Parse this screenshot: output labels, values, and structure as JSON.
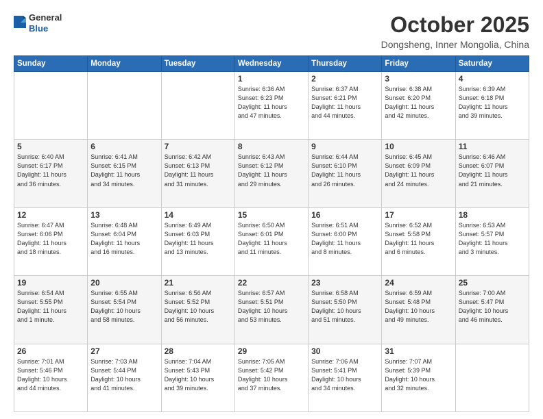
{
  "header": {
    "logo_general": "General",
    "logo_blue": "Blue",
    "month_title": "October 2025",
    "location": "Dongsheng, Inner Mongolia, China"
  },
  "weekdays": [
    "Sunday",
    "Monday",
    "Tuesday",
    "Wednesday",
    "Thursday",
    "Friday",
    "Saturday"
  ],
  "weeks": [
    [
      {
        "day": "",
        "info": ""
      },
      {
        "day": "",
        "info": ""
      },
      {
        "day": "",
        "info": ""
      },
      {
        "day": "1",
        "info": "Sunrise: 6:36 AM\nSunset: 6:23 PM\nDaylight: 11 hours\nand 47 minutes."
      },
      {
        "day": "2",
        "info": "Sunrise: 6:37 AM\nSunset: 6:21 PM\nDaylight: 11 hours\nand 44 minutes."
      },
      {
        "day": "3",
        "info": "Sunrise: 6:38 AM\nSunset: 6:20 PM\nDaylight: 11 hours\nand 42 minutes."
      },
      {
        "day": "4",
        "info": "Sunrise: 6:39 AM\nSunset: 6:18 PM\nDaylight: 11 hours\nand 39 minutes."
      }
    ],
    [
      {
        "day": "5",
        "info": "Sunrise: 6:40 AM\nSunset: 6:17 PM\nDaylight: 11 hours\nand 36 minutes."
      },
      {
        "day": "6",
        "info": "Sunrise: 6:41 AM\nSunset: 6:15 PM\nDaylight: 11 hours\nand 34 minutes."
      },
      {
        "day": "7",
        "info": "Sunrise: 6:42 AM\nSunset: 6:13 PM\nDaylight: 11 hours\nand 31 minutes."
      },
      {
        "day": "8",
        "info": "Sunrise: 6:43 AM\nSunset: 6:12 PM\nDaylight: 11 hours\nand 29 minutes."
      },
      {
        "day": "9",
        "info": "Sunrise: 6:44 AM\nSunset: 6:10 PM\nDaylight: 11 hours\nand 26 minutes."
      },
      {
        "day": "10",
        "info": "Sunrise: 6:45 AM\nSunset: 6:09 PM\nDaylight: 11 hours\nand 24 minutes."
      },
      {
        "day": "11",
        "info": "Sunrise: 6:46 AM\nSunset: 6:07 PM\nDaylight: 11 hours\nand 21 minutes."
      }
    ],
    [
      {
        "day": "12",
        "info": "Sunrise: 6:47 AM\nSunset: 6:06 PM\nDaylight: 11 hours\nand 18 minutes."
      },
      {
        "day": "13",
        "info": "Sunrise: 6:48 AM\nSunset: 6:04 PM\nDaylight: 11 hours\nand 16 minutes."
      },
      {
        "day": "14",
        "info": "Sunrise: 6:49 AM\nSunset: 6:03 PM\nDaylight: 11 hours\nand 13 minutes."
      },
      {
        "day": "15",
        "info": "Sunrise: 6:50 AM\nSunset: 6:01 PM\nDaylight: 11 hours\nand 11 minutes."
      },
      {
        "day": "16",
        "info": "Sunrise: 6:51 AM\nSunset: 6:00 PM\nDaylight: 11 hours\nand 8 minutes."
      },
      {
        "day": "17",
        "info": "Sunrise: 6:52 AM\nSunset: 5:58 PM\nDaylight: 11 hours\nand 6 minutes."
      },
      {
        "day": "18",
        "info": "Sunrise: 6:53 AM\nSunset: 5:57 PM\nDaylight: 11 hours\nand 3 minutes."
      }
    ],
    [
      {
        "day": "19",
        "info": "Sunrise: 6:54 AM\nSunset: 5:55 PM\nDaylight: 11 hours\nand 1 minute."
      },
      {
        "day": "20",
        "info": "Sunrise: 6:55 AM\nSunset: 5:54 PM\nDaylight: 10 hours\nand 58 minutes."
      },
      {
        "day": "21",
        "info": "Sunrise: 6:56 AM\nSunset: 5:52 PM\nDaylight: 10 hours\nand 56 minutes."
      },
      {
        "day": "22",
        "info": "Sunrise: 6:57 AM\nSunset: 5:51 PM\nDaylight: 10 hours\nand 53 minutes."
      },
      {
        "day": "23",
        "info": "Sunrise: 6:58 AM\nSunset: 5:50 PM\nDaylight: 10 hours\nand 51 minutes."
      },
      {
        "day": "24",
        "info": "Sunrise: 6:59 AM\nSunset: 5:48 PM\nDaylight: 10 hours\nand 49 minutes."
      },
      {
        "day": "25",
        "info": "Sunrise: 7:00 AM\nSunset: 5:47 PM\nDaylight: 10 hours\nand 46 minutes."
      }
    ],
    [
      {
        "day": "26",
        "info": "Sunrise: 7:01 AM\nSunset: 5:46 PM\nDaylight: 10 hours\nand 44 minutes."
      },
      {
        "day": "27",
        "info": "Sunrise: 7:03 AM\nSunset: 5:44 PM\nDaylight: 10 hours\nand 41 minutes."
      },
      {
        "day": "28",
        "info": "Sunrise: 7:04 AM\nSunset: 5:43 PM\nDaylight: 10 hours\nand 39 minutes."
      },
      {
        "day": "29",
        "info": "Sunrise: 7:05 AM\nSunset: 5:42 PM\nDaylight: 10 hours\nand 37 minutes."
      },
      {
        "day": "30",
        "info": "Sunrise: 7:06 AM\nSunset: 5:41 PM\nDaylight: 10 hours\nand 34 minutes."
      },
      {
        "day": "31",
        "info": "Sunrise: 7:07 AM\nSunset: 5:39 PM\nDaylight: 10 hours\nand 32 minutes."
      },
      {
        "day": "",
        "info": ""
      }
    ]
  ]
}
